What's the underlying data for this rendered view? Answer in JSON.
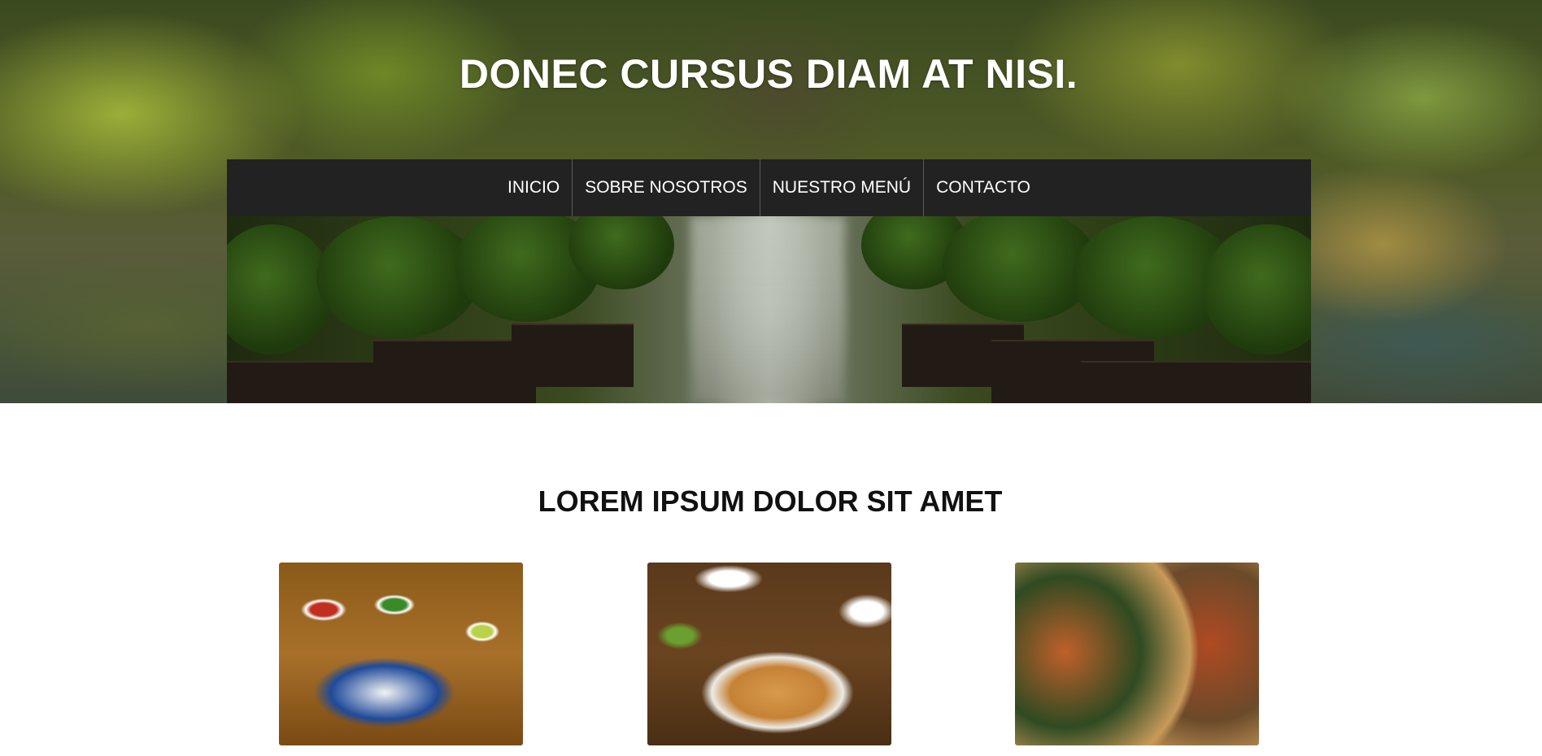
{
  "header": {
    "title": "DONEC CURSUS DIAM AT NISI."
  },
  "nav": {
    "items": [
      {
        "label": "INICIO"
      },
      {
        "label": "SOBRE NOSOTROS"
      },
      {
        "label": "NUESTRO MENÚ"
      },
      {
        "label": "CONTACTO"
      }
    ]
  },
  "main": {
    "section_title": "LOREM IPSUM DOLOR SIT AMET",
    "cards": [
      {
        "image": "mexican-food-plate-photo"
      },
      {
        "image": "fried-shrimp-platter-photo"
      },
      {
        "image": "noodle-bowls-photo"
      }
    ]
  },
  "colors": {
    "nav_background": "#222222",
    "nav_text": "#ffffff",
    "title_text": "#ffffff",
    "section_title_text": "#111111",
    "page_background": "#ffffff"
  }
}
